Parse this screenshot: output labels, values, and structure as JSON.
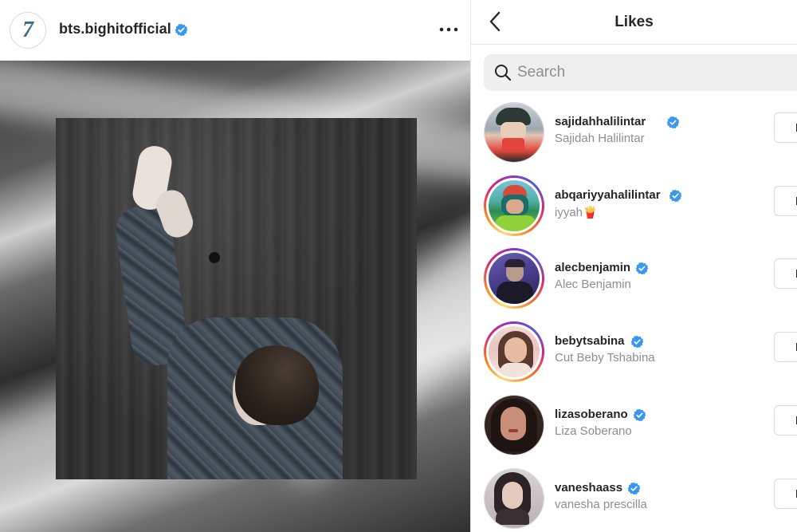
{
  "post": {
    "account_avatar_text": "7",
    "account_name": "bts.bighitofficial",
    "more_icon": "more-horizontal-icon"
  },
  "likes": {
    "title": "Likes",
    "back_icon": "chevron-left-icon",
    "search": {
      "placeholder": "Search",
      "icon": "search-icon"
    },
    "users": [
      {
        "username": "sajidahhalilintar",
        "fullname": "Sajidah Halilintar",
        "verified": true,
        "story_ring": false,
        "follow_label": "F"
      },
      {
        "username": "abqariyyahalilintar",
        "fullname": "iyyah🍟",
        "verified": true,
        "story_ring": true,
        "follow_label": "F"
      },
      {
        "username": "alecbenjamin",
        "fullname": "Alec Benjamin",
        "verified": true,
        "story_ring": true,
        "follow_label": "F"
      },
      {
        "username": "bebytsabina",
        "fullname": "Cut Beby Tshabina",
        "verified": true,
        "story_ring": true,
        "follow_label": "F"
      },
      {
        "username": "lizasoberano",
        "fullname": "Liza Soberano",
        "verified": true,
        "story_ring": false,
        "follow_label": "F"
      },
      {
        "username": "vaneshaass",
        "fullname": "vanesha prescilla",
        "verified": true,
        "story_ring": false,
        "follow_label": "F"
      }
    ]
  },
  "colors": {
    "verified_blue": "#3897f0",
    "text_primary": "#262626",
    "text_secondary": "#8e8e8e",
    "search_bg": "#efefef"
  }
}
